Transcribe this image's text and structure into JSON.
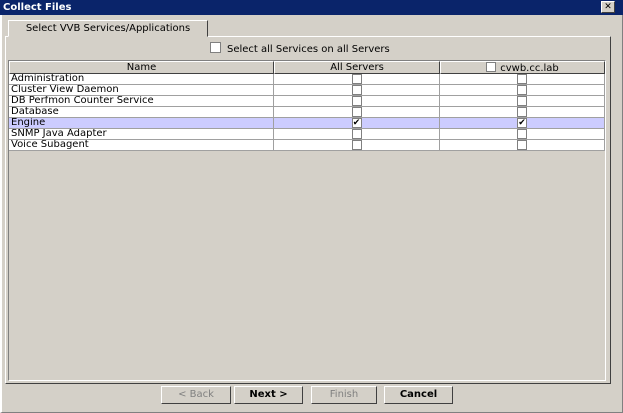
{
  "window": {
    "title": "Collect Files",
    "close_glyph": "✕"
  },
  "tab": {
    "label": "Select VVB Services/Applications"
  },
  "select_all": {
    "label": "Select all Services on all Servers",
    "checked": false
  },
  "table": {
    "headers": {
      "name": "Name",
      "all_servers": "All Servers",
      "server": "cvwb.cc.lab"
    },
    "rows": [
      {
        "name": "Administration",
        "all": "",
        "server": ""
      },
      {
        "name": "Cluster View Daemon",
        "all": "",
        "server": ""
      },
      {
        "name": "DB Perfmon Counter Service",
        "all": "",
        "server": ""
      },
      {
        "name": "Database",
        "all": "",
        "server": ""
      },
      {
        "name": "Engine",
        "all": "✔",
        "server": "✔"
      },
      {
        "name": "SNMP Java Adapter",
        "all": "",
        "server": ""
      },
      {
        "name": "Voice Subagent",
        "all": "",
        "server": ""
      }
    ],
    "selected_row": "Engine"
  },
  "buttons": {
    "back": "< Back",
    "next": "Next >",
    "finish": "Finish",
    "cancel": "Cancel"
  }
}
